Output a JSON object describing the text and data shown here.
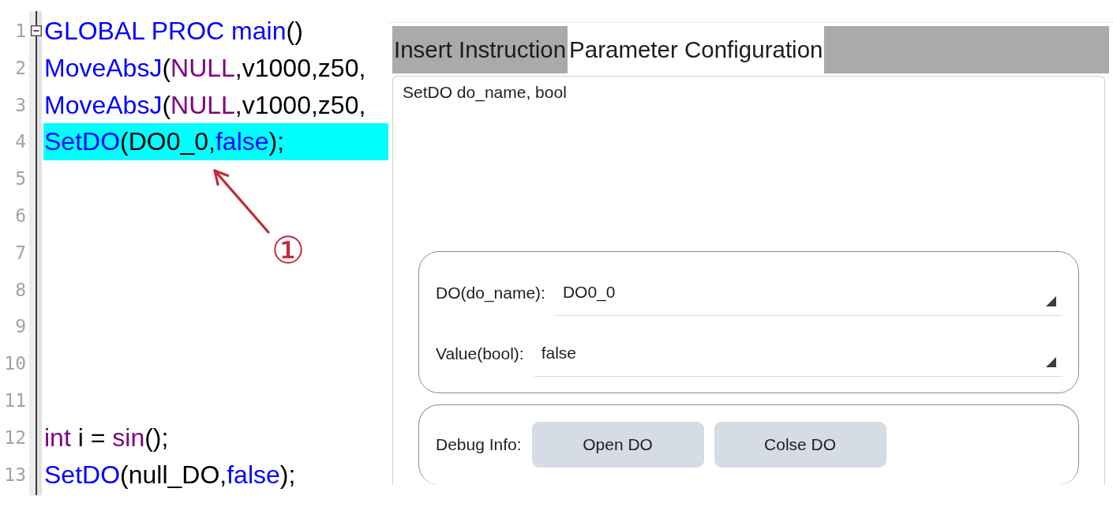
{
  "editor": {
    "lines": [
      {
        "number": "1",
        "foldable": true,
        "highlighted": false,
        "tokens": [
          {
            "text": "GLOBAL PROC main",
            "kind": "keyword"
          },
          {
            "text": "()",
            "kind": "plain"
          }
        ]
      },
      {
        "number": "2",
        "foldable": false,
        "highlighted": false,
        "tokens": [
          {
            "text": "MoveAbsJ",
            "kind": "keyword"
          },
          {
            "text": "(",
            "kind": "plain"
          },
          {
            "text": "NULL",
            "kind": "builtin"
          },
          {
            "text": ",v1000,z50,",
            "kind": "plain"
          }
        ]
      },
      {
        "number": "3",
        "foldable": false,
        "highlighted": false,
        "tokens": [
          {
            "text": "MoveAbsJ",
            "kind": "keyword"
          },
          {
            "text": "(",
            "kind": "plain"
          },
          {
            "text": "NULL",
            "kind": "builtin"
          },
          {
            "text": ",v1000,z50,",
            "kind": "plain"
          }
        ]
      },
      {
        "number": "4",
        "foldable": false,
        "highlighted": true,
        "tokens": [
          {
            "text": "SetDO",
            "kind": "keyword"
          },
          {
            "text": "(DO0_0,",
            "kind": "plain"
          },
          {
            "text": "false",
            "kind": "keyword"
          },
          {
            "text": ");",
            "kind": "plain"
          }
        ]
      },
      {
        "number": "5",
        "foldable": false,
        "highlighted": false
      },
      {
        "number": "6",
        "foldable": false,
        "highlighted": false
      },
      {
        "number": "7",
        "foldable": false,
        "highlighted": false
      },
      {
        "number": "8",
        "foldable": false,
        "highlighted": false
      },
      {
        "number": "9",
        "foldable": false,
        "highlighted": false
      },
      {
        "number": "10",
        "foldable": false,
        "highlighted": false
      },
      {
        "number": "11",
        "foldable": false,
        "highlighted": false
      },
      {
        "number": "12",
        "foldable": false,
        "highlighted": false,
        "tokens": [
          {
            "text": "int",
            "kind": "builtin"
          },
          {
            "text": " i = ",
            "kind": "plain"
          },
          {
            "text": "sin",
            "kind": "builtin"
          },
          {
            "text": "();",
            "kind": "plain"
          }
        ]
      },
      {
        "number": "13",
        "foldable": false,
        "highlighted": false,
        "tokens": [
          {
            "text": "SetDO",
            "kind": "keyword"
          },
          {
            "text": "(null_DO,",
            "kind": "plain"
          },
          {
            "text": "false",
            "kind": "keyword"
          },
          {
            "text": ");",
            "kind": "plain"
          }
        ]
      }
    ]
  },
  "annotation": {
    "label": "①"
  },
  "panel": {
    "tabs": [
      {
        "label": "Insert Instruction",
        "selected": false
      },
      {
        "label": "Parameter Configuration",
        "selected": true
      }
    ],
    "signature": "SetDO do_name, bool",
    "parameters": [
      {
        "label": "DO(do_name):",
        "value": "DO0_0"
      },
      {
        "label": "Value(bool):",
        "value": "false"
      }
    ],
    "debug": {
      "label": "Debug Info:",
      "buttons": [
        "Open DO",
        "Colse DO"
      ]
    }
  }
}
